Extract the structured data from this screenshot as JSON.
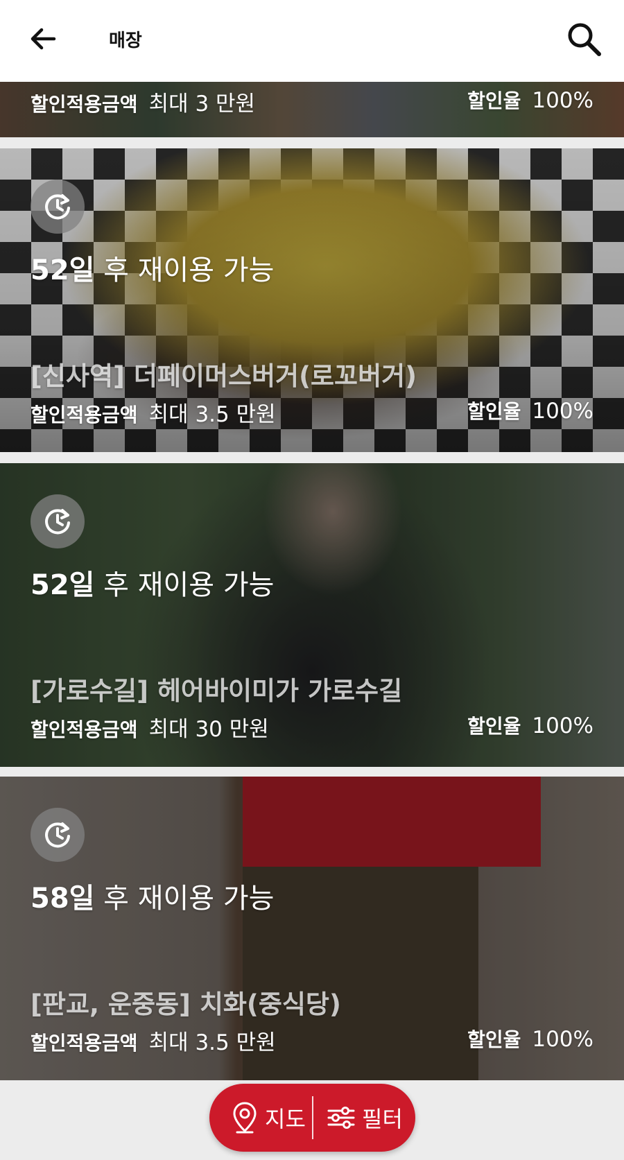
{
  "header": {
    "title": "매장",
    "back_icon": "arrow-left-icon",
    "search_icon": "search-icon"
  },
  "stores": [
    {
      "reuse_days": "",
      "reuse_suffix": "",
      "name": "",
      "discount_label": "할인적용금액",
      "discount_value": "최대 3 만원",
      "rate_label": "할인율",
      "rate_value": "100%"
    },
    {
      "reuse_days": "52일",
      "reuse_suffix": " 후 재이용 가능",
      "name": "[신사역] 더페이머스버거(로꼬버거)",
      "discount_label": "할인적용금액",
      "discount_value": "최대 3.5 만원",
      "rate_label": "할인율",
      "rate_value": "100%"
    },
    {
      "reuse_days": "52일",
      "reuse_suffix": " 후 재이용 가능",
      "name": "[가로수길] 헤어바이미가 가로수길",
      "discount_label": "할인적용금액",
      "discount_value": "최대 30 만원",
      "rate_label": "할인율",
      "rate_value": "100%"
    },
    {
      "reuse_days": "58일",
      "reuse_suffix": " 후 재이용 가능",
      "name": "[판교, 운중동] 치화(중식당)",
      "discount_label": "할인적용금액",
      "discount_value": "최대 3.5 만원",
      "rate_label": "할인율",
      "rate_value": "100%"
    }
  ],
  "fab": {
    "map_label": "지도",
    "filter_label": "필터",
    "map_icon": "map-pin-icon",
    "filter_icon": "sliders-icon"
  },
  "colors": {
    "accent": "#cc1a2a",
    "header_bg": "#ffffff",
    "list_bg": "#ececec"
  }
}
